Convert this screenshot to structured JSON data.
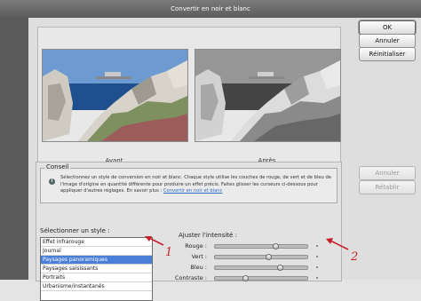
{
  "window": {
    "title": "Convertir en noir et blanc"
  },
  "buttons": {
    "ok": "OK",
    "cancel": "Annuler",
    "reset": "Réinitialiser",
    "undo": "Annuler",
    "redo": "Rétablir"
  },
  "preview": {
    "before_label": "Avant",
    "after_label": "Après"
  },
  "tip": {
    "title": "Conseil",
    "text": "Sélectionnez un style de conversion en noir et blanc. Chaque style utilise les couches de rouge, de vert et de bleu de l'image d'origine en quantité différente pour produire un effet précis. Faites glisser les curseurs ci-dessous pour appliquer d'autres réglages. En savoir plus :",
    "link": "Convertir en noir et blanc"
  },
  "style_section": {
    "label": "Sélectionner un style :",
    "options": [
      "Effet infrarouge",
      "Journal",
      "Paysages panoramiques",
      "Paysages saisissants",
      "Portraits",
      "Urbanisme/instantanés"
    ],
    "selected": "Paysages panoramiques"
  },
  "intensity": {
    "title": "Ajuster l'intensité :",
    "sliders": [
      {
        "label": "Rouge :",
        "value": 0.65
      },
      {
        "label": "Vert :",
        "value": 0.58
      },
      {
        "label": "Bleu :",
        "value": 0.7
      },
      {
        "label": "Contraste :",
        "value": 0.33
      }
    ]
  },
  "annotations": {
    "one": "1",
    "two": "2"
  },
  "colors": {
    "selection": "#4a7fd8",
    "annotation": "#c8202a",
    "link": "#2d6bc6"
  }
}
